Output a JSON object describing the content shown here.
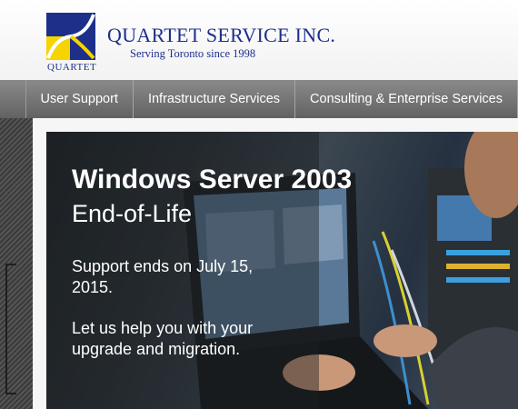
{
  "header": {
    "company_name": "QUARTET SERVICE INC.",
    "tagline": "Serving Toronto since 1998",
    "logo_text": "QUARTET"
  },
  "nav": {
    "items": [
      {
        "label": "User Support"
      },
      {
        "label": "Infrastructure Services"
      },
      {
        "label": "Consulting & Enterprise Services"
      }
    ]
  },
  "hero": {
    "title_line1": "Windows Server 2003",
    "title_line2": "End-of-Life",
    "support_text": "Support ends on July 15, 2015.",
    "help_text": "Let us help you with your upgrade and migration."
  },
  "colors": {
    "brand_blue": "#1e2f8a",
    "logo_yellow": "#f5d400",
    "nav_gray": "#7a7a7a"
  }
}
